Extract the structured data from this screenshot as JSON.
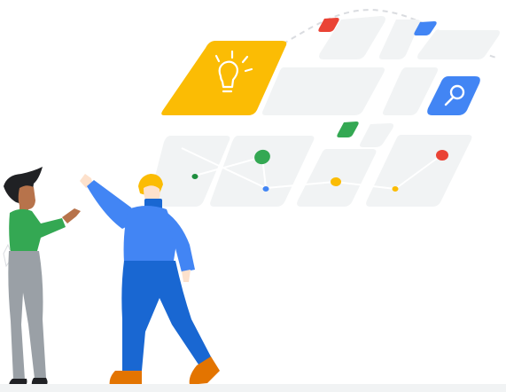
{
  "illustration": {
    "colors": {
      "tile": "#f1f3f4",
      "yellow": "#fbbc04",
      "blue": "#4285f4",
      "dark_blue": "#1967d2",
      "green": "#34a853",
      "dark_green": "#1e8e3e",
      "red": "#ea4335",
      "orange": "#e37400",
      "skin_light": "#fde1cc",
      "skin_dark": "#b7734b",
      "hair_dark": "#202124",
      "grey_pants": "#9aa0a6",
      "white": "#ffffff"
    },
    "icons": [
      "lightbulb-icon",
      "search-icon"
    ]
  }
}
